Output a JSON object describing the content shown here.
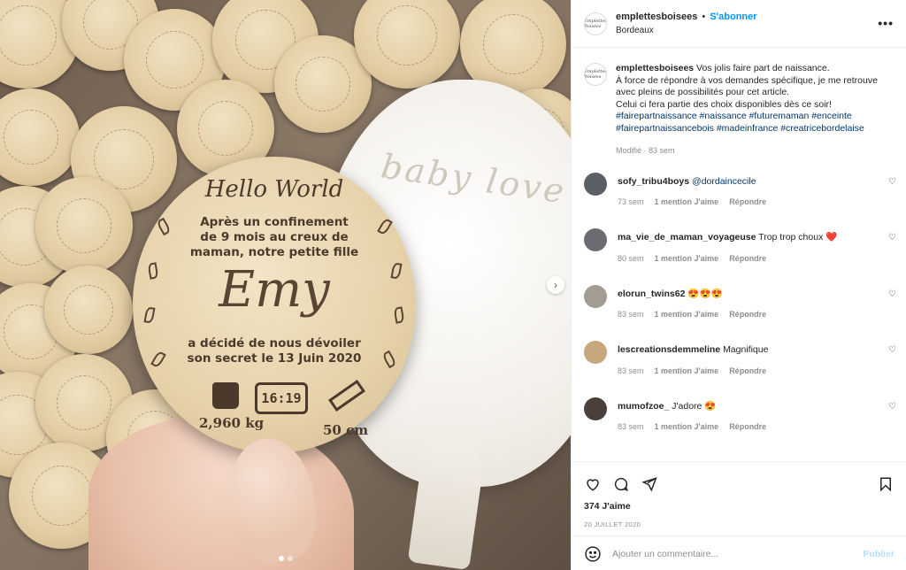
{
  "photo": {
    "disc": {
      "hello": "Hello World",
      "line1": "Après un confinement",
      "line2": "de 9 mois au creux de",
      "line3": "maman, notre petite fille",
      "name": "Emy",
      "line4": "a décidé de nous dévoiler",
      "line5": "son secret le 13 Juin 2020",
      "time": "16:19",
      "weight": "2,960 kg",
      "size": "50 cm"
    },
    "pillow_text": "baby love",
    "carousel": {
      "index": 1,
      "count": 2
    }
  },
  "header": {
    "username": "emplettesboisees",
    "separator": "•",
    "follow_label": "S'abonner",
    "location": "Bordeaux",
    "more_label": "•••",
    "avatar_text": "Emplettes Boisées"
  },
  "caption": {
    "username": "emplettesboisees",
    "text_line1": "Vos jolis faire part de naissance.",
    "text_line2": "À force de répondre à vos demandes spécifique, je me retrouve avec pleins de possibilités pour cet article.",
    "text_line3": "Celui ci fera partie des choix disponibles dès ce soir!",
    "hashtags": "#fairepartnaissance #naissance #futuremaman #enceinte #fairepartnaissancebois #madeinfrance #creatricebordelaise",
    "meta": "Modifié · 83 sem"
  },
  "comments": [
    {
      "username": "sofy_tribu4boys",
      "text": "",
      "mention": "@dordaincecile",
      "time": "73 sem",
      "likes": "1 mention J'aime",
      "reply": "Répondre",
      "avatar_color": "#5b5f66"
    },
    {
      "username": "ma_vie_de_maman_voyageuse",
      "text": "Trop trop choux ❤️",
      "mention": "",
      "time": "80 sem",
      "likes": "1 mention J'aime",
      "reply": "Répondre",
      "avatar_color": "#6d6a72"
    },
    {
      "username": "elorun_twins62",
      "text": "😍😍😍",
      "mention": "",
      "time": "83 sem",
      "likes": "1 mention J'aime",
      "reply": "Répondre",
      "avatar_color": "#a39c93"
    },
    {
      "username": "lescreationsdemmeline",
      "text": "Magnifique",
      "mention": "",
      "time": "83 sem",
      "likes": "1 mention J'aime",
      "reply": "Répondre",
      "avatar_color": "#c7a77e"
    },
    {
      "username": "mumofzoe_",
      "text": "J'adore 😍",
      "mention": "",
      "time": "83 sem",
      "likes": "1 mention J'aime",
      "reply": "Répondre",
      "avatar_color": "#4a3f3a"
    }
  ],
  "actions": {
    "likes": "374 J'aime",
    "date": "20 JUILLET 2020"
  },
  "add_comment": {
    "placeholder": "Ajouter un commentaire...",
    "publish": "Publier"
  }
}
